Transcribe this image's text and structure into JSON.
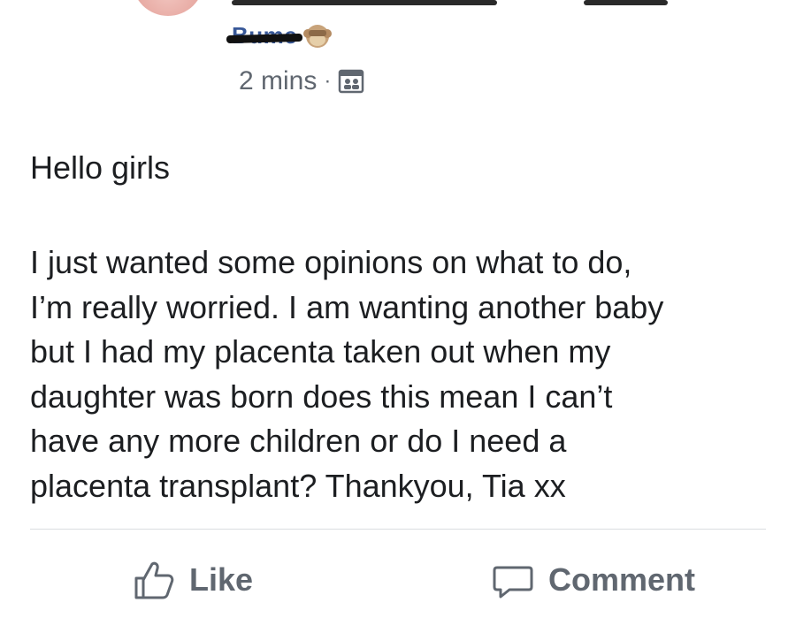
{
  "post": {
    "author_name": "Bume",
    "timestamp": "2 mins",
    "separator": "·",
    "audience_icon": "group-icon",
    "greeting": "Hello girls",
    "body_lines": [
      "I just wanted some opinions on what to do,",
      "I’m really worried. I am wanting another baby",
      "but I had my placenta taken out when my",
      "daughter was born does this mean I can’t",
      "have any more children or do I need a",
      "placenta transplant? Thankyou, Tia xx"
    ]
  },
  "actions": {
    "like_label": "Like",
    "comment_label": "Comment"
  },
  "colors": {
    "text": "#1c1e21",
    "secondary": "#606770",
    "author_link": "#385898",
    "divider": "#dadde1"
  }
}
